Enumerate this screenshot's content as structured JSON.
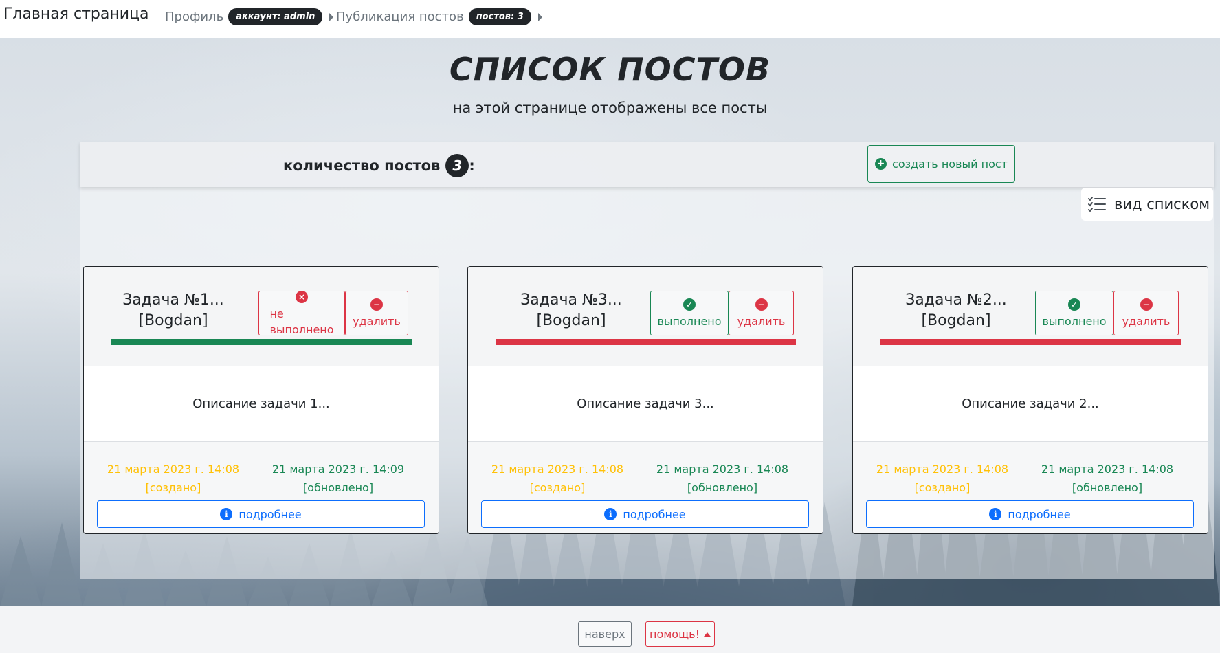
{
  "navbar": {
    "brand": "Главная страница",
    "profile": {
      "label": "Профиль",
      "badge": "аккаунт: admin"
    },
    "posts": {
      "label": "Публикация постов",
      "badge": "постов: 3"
    }
  },
  "hero": {
    "title": "СПИСОК ПОСТОВ",
    "subtitle": "на этой странице отображены все посты"
  },
  "toolbar": {
    "count_label": "количество постов",
    "count_value": "3",
    "count_suffix": ":",
    "create_label": "создать новый пост",
    "view_label": "вид списком"
  },
  "cards": [
    {
      "title_line1": "Задача №1...",
      "title_line2": "[Bogdan]",
      "status_label_1": "не",
      "status_label_2": "выполнено",
      "status": "not-done",
      "delete_label": "удалить",
      "bar_color": "#198754",
      "description": "Описание задачи 1...",
      "created_date": "21 марта 2023 г. 14:08",
      "created_label": "[создано]",
      "updated_date": "21 марта 2023 г. 14:09",
      "updated_label": "[обновлено]",
      "more_label": "подробнее"
    },
    {
      "title_line1": "Задача №3...",
      "title_line2": "[Bogdan]",
      "status_label_1": "",
      "status_label_2": "выполнено",
      "status": "done",
      "delete_label": "удалить",
      "bar_color": "#dc3545",
      "description": "Описание задачи 3...",
      "created_date": "21 марта 2023 г. 14:08",
      "created_label": "[создано]",
      "updated_date": "21 марта 2023 г. 14:08",
      "updated_label": "[обновлено]",
      "more_label": "подробнее"
    },
    {
      "title_line1": "Задача №2...",
      "title_line2": "[Bogdan]",
      "status_label_1": "",
      "status_label_2": "выполнено",
      "status": "done",
      "delete_label": "удалить",
      "bar_color": "#dc3545",
      "description": "Описание задачи 2...",
      "created_date": "21 марта 2023 г. 14:08",
      "created_label": "[создано]",
      "updated_date": "21 марта 2023 г. 14:08",
      "updated_label": "[обновлено]",
      "more_label": "подробнее"
    }
  ],
  "footer": {
    "top_label": "наверх",
    "help_label": "помощь!"
  },
  "colors": {
    "success": "#198754",
    "danger": "#dc3545",
    "warning": "#ffc107",
    "primary": "#0d6efd",
    "dark": "#212529"
  },
  "icons": {
    "create": "plus-circle-icon",
    "view": "list-check-icon",
    "not_done": "x-circle-icon",
    "done": "check-circle-icon",
    "delete": "dash-circle-icon",
    "more": "info-circle-icon",
    "help": "caret-up-icon"
  }
}
